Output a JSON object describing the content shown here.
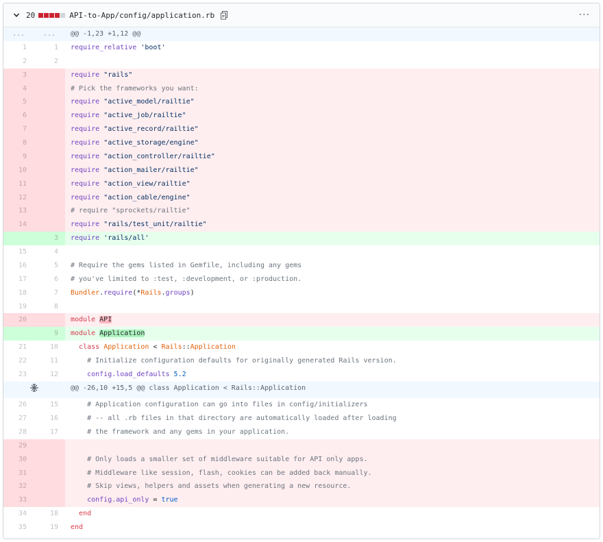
{
  "file_header": {
    "changed_count": "20",
    "diffstat_colors": [
      "#cb2431",
      "#cb2431",
      "#cb2431",
      "#cb2431",
      "#d1d5da"
    ],
    "path": "API-to-App/config/application.rb",
    "more_label": "···"
  },
  "hunks": [
    {
      "left": "...",
      "right": "...",
      "text": "@@ -1,23 +1,12 @@"
    },
    {
      "left": "",
      "right": "",
      "text": "@@ -26,10 +15,5 @@ class Application < Rails::Application"
    }
  ],
  "lines": [
    {
      "t": "ctx",
      "l": "1",
      "r": "1",
      "code": [
        {
          "c": "kw",
          "v": "require_relative"
        },
        {
          "v": " "
        },
        {
          "c": "str",
          "v": "'boot'"
        }
      ]
    },
    {
      "t": "ctx",
      "l": "2",
      "r": "2",
      "code": []
    },
    {
      "t": "del",
      "l": "3",
      "r": "",
      "code": [
        {
          "c": "kw",
          "v": "require"
        },
        {
          "v": " "
        },
        {
          "c": "str",
          "v": "\"rails\""
        }
      ]
    },
    {
      "t": "del",
      "l": "4",
      "r": "",
      "code": [
        {
          "c": "cmt",
          "v": "# Pick the frameworks you want:"
        }
      ]
    },
    {
      "t": "del",
      "l": "5",
      "r": "",
      "code": [
        {
          "c": "kw",
          "v": "require"
        },
        {
          "v": " "
        },
        {
          "c": "str",
          "v": "\"active_model/railtie\""
        }
      ]
    },
    {
      "t": "del",
      "l": "6",
      "r": "",
      "code": [
        {
          "c": "kw",
          "v": "require"
        },
        {
          "v": " "
        },
        {
          "c": "str",
          "v": "\"active_job/railtie\""
        }
      ]
    },
    {
      "t": "del",
      "l": "7",
      "r": "",
      "code": [
        {
          "c": "kw",
          "v": "require"
        },
        {
          "v": " "
        },
        {
          "c": "str",
          "v": "\"active_record/railtie\""
        }
      ]
    },
    {
      "t": "del",
      "l": "8",
      "r": "",
      "code": [
        {
          "c": "kw",
          "v": "require"
        },
        {
          "v": " "
        },
        {
          "c": "str",
          "v": "\"active_storage/engine\""
        }
      ]
    },
    {
      "t": "del",
      "l": "9",
      "r": "",
      "code": [
        {
          "c": "kw",
          "v": "require"
        },
        {
          "v": " "
        },
        {
          "c": "str",
          "v": "\"action_controller/railtie\""
        }
      ]
    },
    {
      "t": "del",
      "l": "10",
      "r": "",
      "code": [
        {
          "c": "kw",
          "v": "require"
        },
        {
          "v": " "
        },
        {
          "c": "str",
          "v": "\"action_mailer/railtie\""
        }
      ]
    },
    {
      "t": "del",
      "l": "11",
      "r": "",
      "code": [
        {
          "c": "kw",
          "v": "require"
        },
        {
          "v": " "
        },
        {
          "c": "str",
          "v": "\"action_view/railtie\""
        }
      ]
    },
    {
      "t": "del",
      "l": "12",
      "r": "",
      "code": [
        {
          "c": "kw",
          "v": "require"
        },
        {
          "v": " "
        },
        {
          "c": "str",
          "v": "\"action_cable/engine\""
        }
      ]
    },
    {
      "t": "del",
      "l": "13",
      "r": "",
      "code": [
        {
          "c": "cmt",
          "v": "# require \"sprockets/railtie\""
        }
      ]
    },
    {
      "t": "del",
      "l": "14",
      "r": "",
      "code": [
        {
          "c": "kw",
          "v": "require"
        },
        {
          "v": " "
        },
        {
          "c": "str",
          "v": "\"rails/test_unit/railtie\""
        }
      ]
    },
    {
      "t": "add",
      "l": "",
      "r": "3",
      "code": [
        {
          "c": "kw",
          "v": "require"
        },
        {
          "v": " "
        },
        {
          "c": "str",
          "v": "'rails/all'"
        }
      ]
    },
    {
      "t": "ctx",
      "l": "15",
      "r": "4",
      "code": []
    },
    {
      "t": "ctx",
      "l": "16",
      "r": "5",
      "code": [
        {
          "c": "cmt",
          "v": "# Require the gems listed in Gemfile, including any gems"
        }
      ]
    },
    {
      "t": "ctx",
      "l": "17",
      "r": "6",
      "code": [
        {
          "c": "cmt",
          "v": "# you've limited to :test, :development, or :production."
        }
      ]
    },
    {
      "t": "ctx",
      "l": "18",
      "r": "7",
      "code": [
        {
          "c": "cls",
          "v": "Bundler"
        },
        {
          "v": "."
        },
        {
          "c": "kw",
          "v": "require"
        },
        {
          "v": "(*"
        },
        {
          "c": "cls",
          "v": "Rails"
        },
        {
          "v": "."
        },
        {
          "c": "kw",
          "v": "groups"
        },
        {
          "v": ")"
        }
      ]
    },
    {
      "t": "ctx",
      "l": "19",
      "r": "8",
      "code": []
    },
    {
      "t": "del",
      "l": "20",
      "r": "",
      "code": [
        {
          "c": "kwr",
          "v": "module"
        },
        {
          "v": " "
        },
        {
          "c": "del-hl",
          "v": "API"
        }
      ]
    },
    {
      "t": "add",
      "l": "",
      "r": "9",
      "code": [
        {
          "c": "kwr",
          "v": "module"
        },
        {
          "v": " "
        },
        {
          "c": "add-hl",
          "v": "Application"
        }
      ]
    },
    {
      "t": "ctx",
      "l": "21",
      "r": "10",
      "code": [
        {
          "v": "  "
        },
        {
          "c": "kwr",
          "v": "class"
        },
        {
          "v": " "
        },
        {
          "c": "cls",
          "v": "Application"
        },
        {
          "v": " < "
        },
        {
          "c": "cls",
          "v": "Rails"
        },
        {
          "v": "::"
        },
        {
          "c": "cls",
          "v": "Application"
        }
      ]
    },
    {
      "t": "ctx",
      "l": "22",
      "r": "11",
      "code": [
        {
          "v": "    "
        },
        {
          "c": "cmt",
          "v": "# Initialize configuration defaults for originally generated Rails version."
        }
      ]
    },
    {
      "t": "ctx",
      "l": "23",
      "r": "12",
      "code": [
        {
          "v": "    "
        },
        {
          "c": "kw",
          "v": "config.load_defaults"
        },
        {
          "v": " "
        },
        {
          "c": "num-lit",
          "v": "5.2"
        }
      ]
    },
    {
      "t": "hunk",
      "idx": 1
    },
    {
      "t": "ctx",
      "l": "26",
      "r": "15",
      "code": [
        {
          "v": "    "
        },
        {
          "c": "cmt",
          "v": "# Application configuration can go into files in config/initializers"
        }
      ]
    },
    {
      "t": "ctx",
      "l": "27",
      "r": "16",
      "code": [
        {
          "v": "    "
        },
        {
          "c": "cmt",
          "v": "# -- all .rb files in that directory are automatically loaded after loading"
        }
      ]
    },
    {
      "t": "ctx",
      "l": "28",
      "r": "17",
      "code": [
        {
          "v": "    "
        },
        {
          "c": "cmt",
          "v": "# the framework and any gems in your application."
        }
      ]
    },
    {
      "t": "del",
      "l": "29",
      "r": "",
      "code": []
    },
    {
      "t": "del",
      "l": "30",
      "r": "",
      "code": [
        {
          "v": "    "
        },
        {
          "c": "cmt",
          "v": "# Only loads a smaller set of middleware suitable for API only apps."
        }
      ]
    },
    {
      "t": "del",
      "l": "31",
      "r": "",
      "code": [
        {
          "v": "    "
        },
        {
          "c": "cmt",
          "v": "# Middleware like session, flash, cookies can be added back manually."
        }
      ]
    },
    {
      "t": "del",
      "l": "32",
      "r": "",
      "code": [
        {
          "v": "    "
        },
        {
          "c": "cmt",
          "v": "# Skip views, helpers and assets when generating a new resource."
        }
      ]
    },
    {
      "t": "del",
      "l": "33",
      "r": "",
      "code": [
        {
          "v": "    "
        },
        {
          "c": "kw",
          "v": "config.api_only"
        },
        {
          "v": " = "
        },
        {
          "c": "num-lit",
          "v": "true"
        }
      ]
    },
    {
      "t": "ctx",
      "l": "34",
      "r": "18",
      "code": [
        {
          "v": "  "
        },
        {
          "c": "kwr",
          "v": "end"
        }
      ]
    },
    {
      "t": "ctx",
      "l": "35",
      "r": "19",
      "code": [
        {
          "c": "kwr",
          "v": "end"
        }
      ]
    }
  ]
}
